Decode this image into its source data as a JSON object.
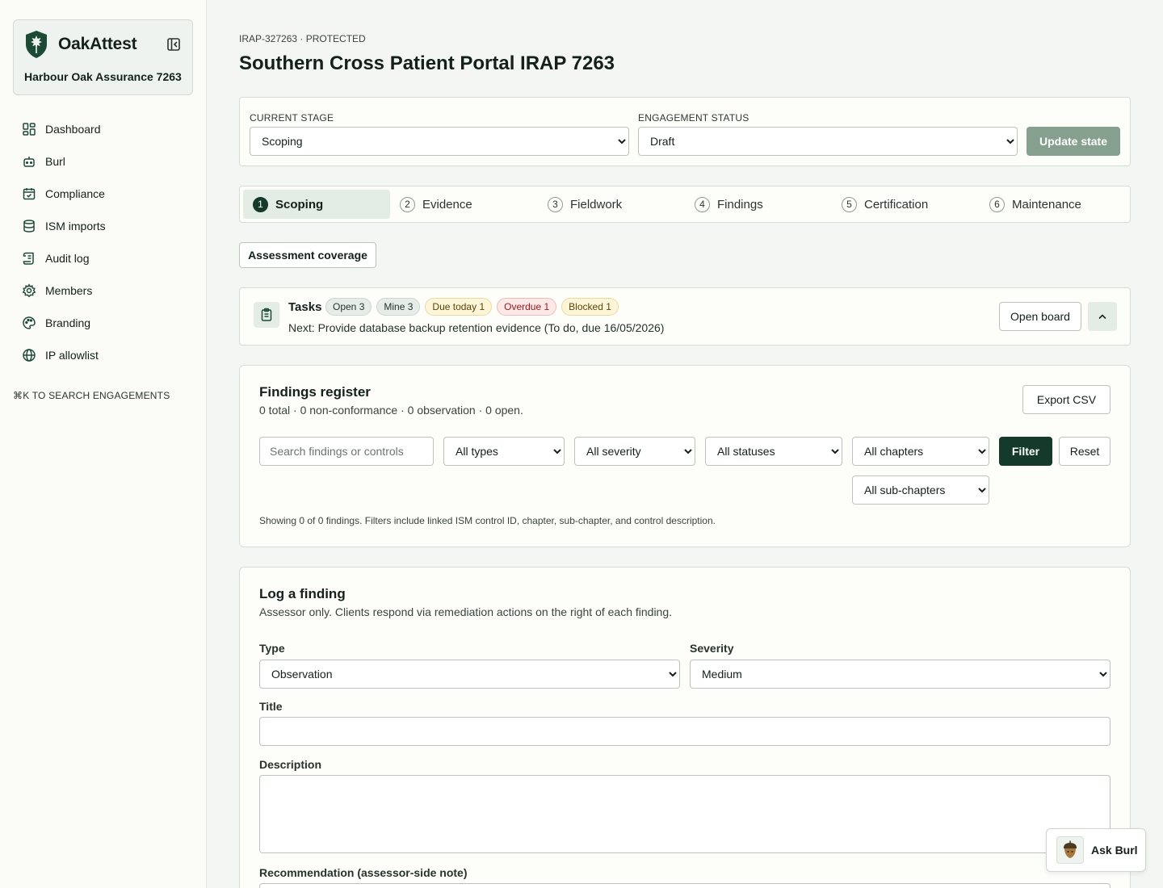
{
  "sidebar": {
    "brand": "OakAttest",
    "org": "Harbour Oak Assurance 7263",
    "items": [
      {
        "label": "Dashboard",
        "icon": "dashboard-icon"
      },
      {
        "label": "Burl",
        "icon": "robot-icon"
      },
      {
        "label": "Compliance",
        "icon": "calendar-check-icon"
      },
      {
        "label": "ISM imports",
        "icon": "database-icon"
      },
      {
        "label": "Audit log",
        "icon": "scroll-icon"
      },
      {
        "label": "Members",
        "icon": "gear-icon"
      },
      {
        "label": "Branding",
        "icon": "palette-icon"
      },
      {
        "label": "IP allowlist",
        "icon": "globe-icon"
      }
    ],
    "search_hint": "⌘K TO SEARCH ENGAGEMENTS"
  },
  "header": {
    "eyebrow": "IRAP-327263 · PROTECTED",
    "title": "Southern Cross Patient Portal IRAP 7263"
  },
  "state": {
    "stage_label": "CURRENT STAGE",
    "stage_value": "Scoping",
    "status_label": "ENGAGEMENT STATUS",
    "status_value": "Draft",
    "update_button": "Update state"
  },
  "steps": [
    {
      "num": "1",
      "label": "Scoping",
      "active": true
    },
    {
      "num": "2",
      "label": "Evidence"
    },
    {
      "num": "3",
      "label": "Fieldwork"
    },
    {
      "num": "4",
      "label": "Findings"
    },
    {
      "num": "5",
      "label": "Certification"
    },
    {
      "num": "6",
      "label": "Maintenance"
    }
  ],
  "coverage_button": "Assessment coverage",
  "tasks": {
    "title": "Tasks",
    "badges": {
      "open": "Open 3",
      "mine": "Mine 3",
      "due_today": "Due today 1",
      "overdue": "Overdue 1",
      "blocked": "Blocked 1"
    },
    "next": "Next: Provide database backup retention evidence (To do, due 16/05/2026)",
    "open_board": "Open board"
  },
  "findings": {
    "title": "Findings register",
    "summary": "0 total · 0 non-conformance · 0 observation · 0 open.",
    "export": "Export CSV",
    "search_placeholder": "Search findings or controls",
    "filters": {
      "types": "All types",
      "severity": "All severity",
      "statuses": "All statuses",
      "chapters": "All chapters",
      "subchapters": "All sub-chapters"
    },
    "filter_button": "Filter",
    "reset_button": "Reset",
    "note": "Showing 0 of 0 findings. Filters include linked ISM control ID, chapter, sub-chapter, and control description."
  },
  "log": {
    "title": "Log a finding",
    "subtitle": "Assessor only. Clients respond via remediation actions on the right of each finding.",
    "type_label": "Type",
    "type_value": "Observation",
    "severity_label": "Severity",
    "severity_value": "Medium",
    "title_label": "Title",
    "description_label": "Description",
    "recommendation_label": "Recommendation (assessor-side note)"
  },
  "ask": {
    "label": "Ask Burl"
  }
}
